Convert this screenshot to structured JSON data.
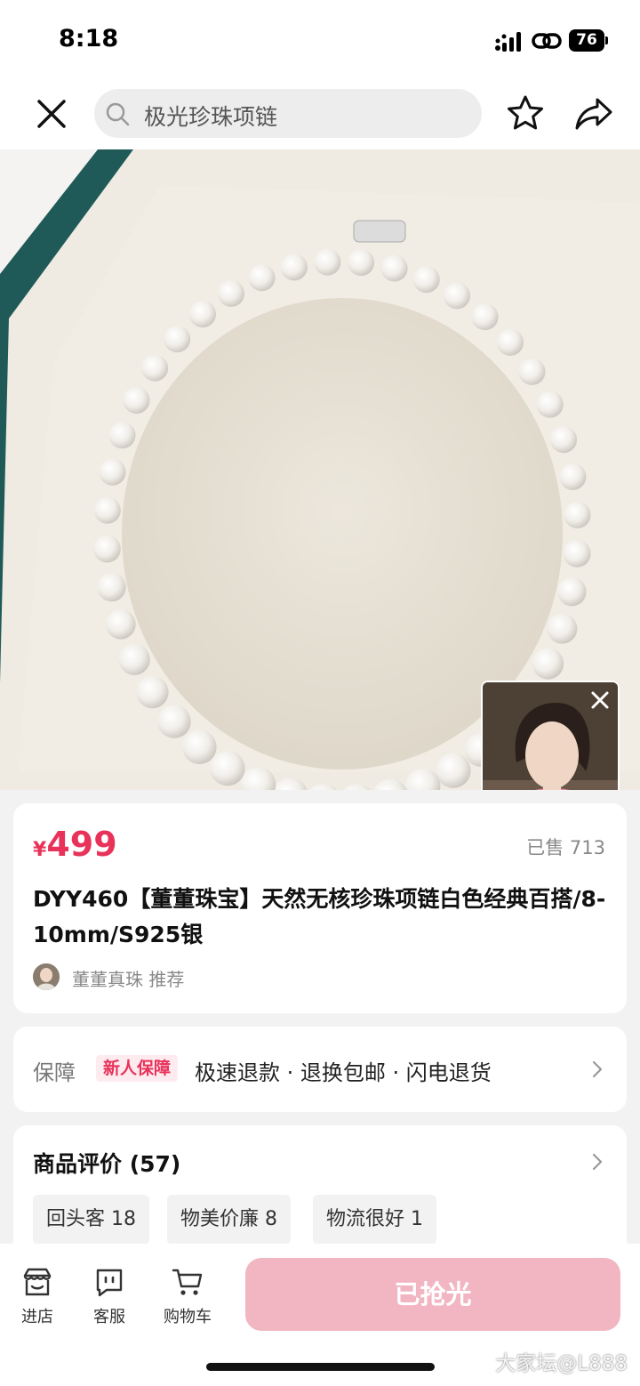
{
  "status_bar": {
    "time": "8:18",
    "battery": "76"
  },
  "header": {
    "search_placeholder": "极光珍珠项链"
  },
  "product": {
    "currency": "¥",
    "price": "499",
    "sold": "已售 713",
    "title": "DYY460【董董珠宝】天然无核珍珠项链白色经典百搭/8-10mm/S925银",
    "seller": "董董真珠 推荐"
  },
  "guarantee": {
    "label": "保障",
    "badge": "新人保障",
    "items": "极速退款 · 退换包邮 · 闪电退货"
  },
  "reviews": {
    "title": "商品评价 (57)",
    "tags": [
      "回头客 18",
      "物美价廉 8",
      "物流很好 1"
    ]
  },
  "bottom_bar": {
    "nav": [
      "进店",
      "客服",
      "购物车"
    ],
    "buy_label": "已抢光"
  },
  "watermark": "大家坛@L888",
  "colors": {
    "accent": "#e8325a",
    "buy_disabled": "#f2b6c3"
  }
}
